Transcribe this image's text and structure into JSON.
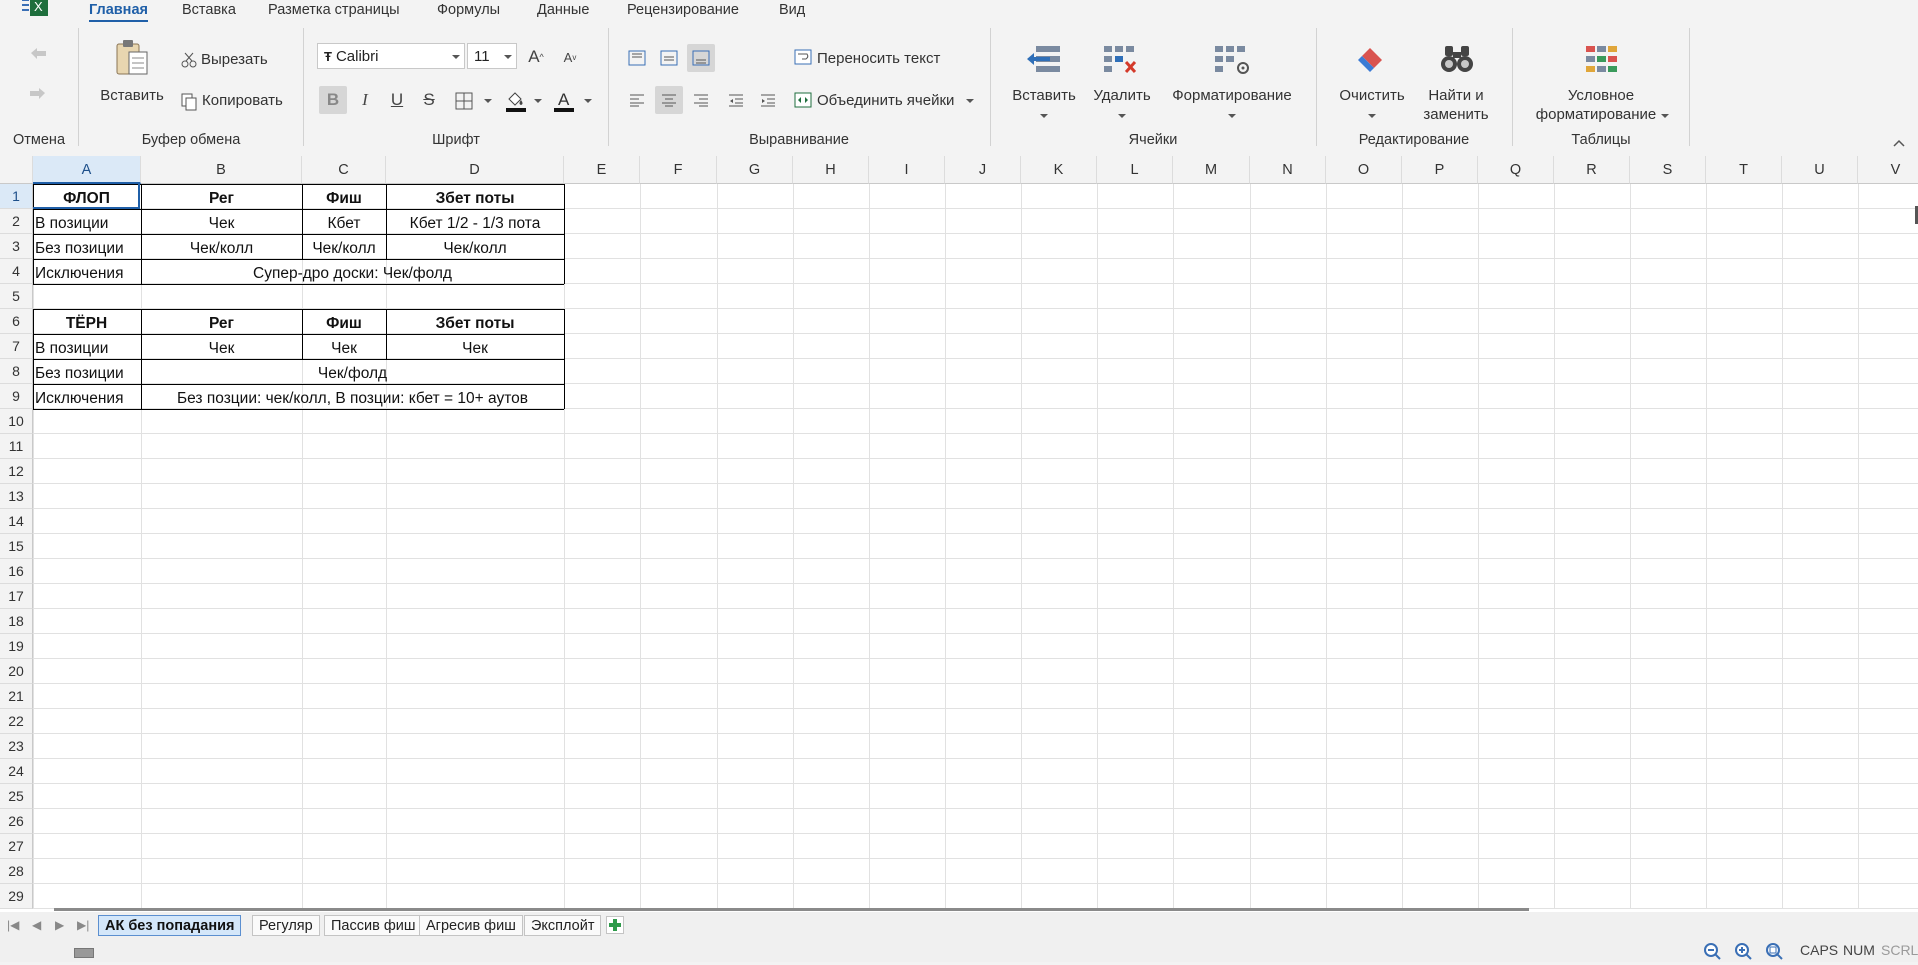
{
  "menu": {
    "app_icon": "excel-icon",
    "tabs": [
      "Главная",
      "Вставка",
      "Разметка страницы",
      "Формулы",
      "Данные",
      "Рецензирование",
      "Вид"
    ],
    "active_tab": "Главная"
  },
  "ribbon": {
    "undo": {
      "label": "Отмена"
    },
    "clipboard": {
      "label": "Буфер обмена",
      "paste": "Вставить",
      "cut": "Вырезать",
      "copy": "Копировать"
    },
    "font": {
      "label": "Шрифт",
      "family": "Calibri",
      "size": "11"
    },
    "alignment": {
      "label": "Выравнивание",
      "wrap": "Переносить текст",
      "merge": "Объединить ячейки"
    },
    "cells": {
      "label": "Ячейки",
      "insert": "Вставить",
      "delete": "Удалить",
      "format": "Форматирование"
    },
    "editing": {
      "label": "Редактирование",
      "clear": "Очистить",
      "find_line1": "Найти и",
      "find_line2": "заменить"
    },
    "tables": {
      "label": "Таблицы",
      "cond_line1": "Условное",
      "cond_line2": "форматирование"
    }
  },
  "grid": {
    "selected_cell": "A1",
    "columns": [
      "A",
      "B",
      "C",
      "D",
      "E",
      "F",
      "G",
      "H",
      "I",
      "J",
      "K",
      "L",
      "M",
      "N",
      "O",
      "P",
      "Q",
      "R",
      "S",
      "T",
      "U",
      "V"
    ],
    "rows": [
      1,
      2,
      3,
      4,
      5,
      6,
      7,
      8,
      9,
      10,
      11,
      12,
      13,
      14,
      15,
      16,
      17,
      18,
      19,
      20,
      21,
      22,
      23,
      24,
      25,
      26,
      27,
      28,
      29
    ],
    "cells": {
      "A1": "ФЛОП",
      "B1": "Рег",
      "C1": "Фиш",
      "D1": "Збет поты",
      "A2": "В позиции",
      "B2": "Чек",
      "C2": "Кбет",
      "D2": "Кбет 1/2 - 1/3 пота",
      "A3": "Без позиции",
      "B3": "Чек/колл",
      "C3": "Чек/колл",
      "D3": "Чек/колл",
      "A4": "Исключения",
      "B4": "Супер-дро доски: Чек/фолд",
      "A6": "ТЁРН",
      "B6": "Рег",
      "C6": "Фиш",
      "D6": "Збет поты",
      "A7": "В позиции",
      "B7": "Чек",
      "C7": "Чек",
      "D7": "Чек",
      "A8": "Без позиции",
      "B8": "Чек/фолд",
      "A9": "Исключения",
      "B9": "Без позции: чек/колл, В позции: кбет = 10+ аутов"
    }
  },
  "sheets": {
    "tabs": [
      "АК без попадания",
      "Регуляр",
      "Пассив фиш",
      "Агресив фиш",
      "Эксплойт"
    ],
    "active": "АК без попадания"
  },
  "status": {
    "caps": "CAPS",
    "num": "NUM",
    "scrl": "SCRL"
  }
}
